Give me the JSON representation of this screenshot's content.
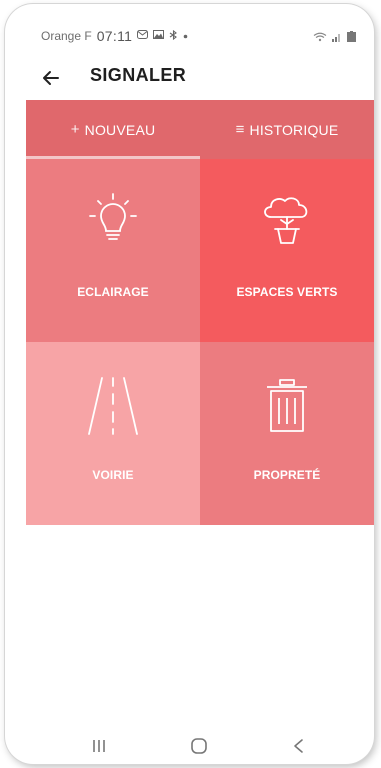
{
  "status_bar": {
    "carrier": "Orange F",
    "time": "07:11",
    "icons_left": [
      "mail-icon",
      "gallery-icon",
      "bluetooth-icon",
      "dot-icon"
    ],
    "icons_right": [
      "wifi-icon",
      "signal-icon",
      "battery-icon"
    ]
  },
  "app_bar": {
    "back_icon": "arrow-left-icon",
    "title": "SIGNALER"
  },
  "tabs": [
    {
      "prefix": "+",
      "label": "NOUVEAU",
      "active": true
    },
    {
      "prefix": "≡",
      "label": "HISTORIQUE",
      "active": false
    }
  ],
  "colors": {
    "tab_bar": "#e0686c",
    "eclairage": "#ec7c80",
    "espaces_verts": "#f45b5e",
    "voirie": "#f7a4a6",
    "proprete": "#ec7c80",
    "indicator": "#f3c6c8"
  },
  "categories": [
    {
      "label": "ECLAIRAGE",
      "icon": "lightbulb-icon"
    },
    {
      "label": "ESPACES VERTS",
      "icon": "potted-tree-icon"
    },
    {
      "label": "VOIRIE",
      "icon": "road-icon"
    },
    {
      "label": "PROPRETÉ",
      "icon": "trash-bin-icon"
    }
  ],
  "nav_bar": {
    "items": [
      "recents-icon",
      "home-icon",
      "back-icon"
    ]
  }
}
